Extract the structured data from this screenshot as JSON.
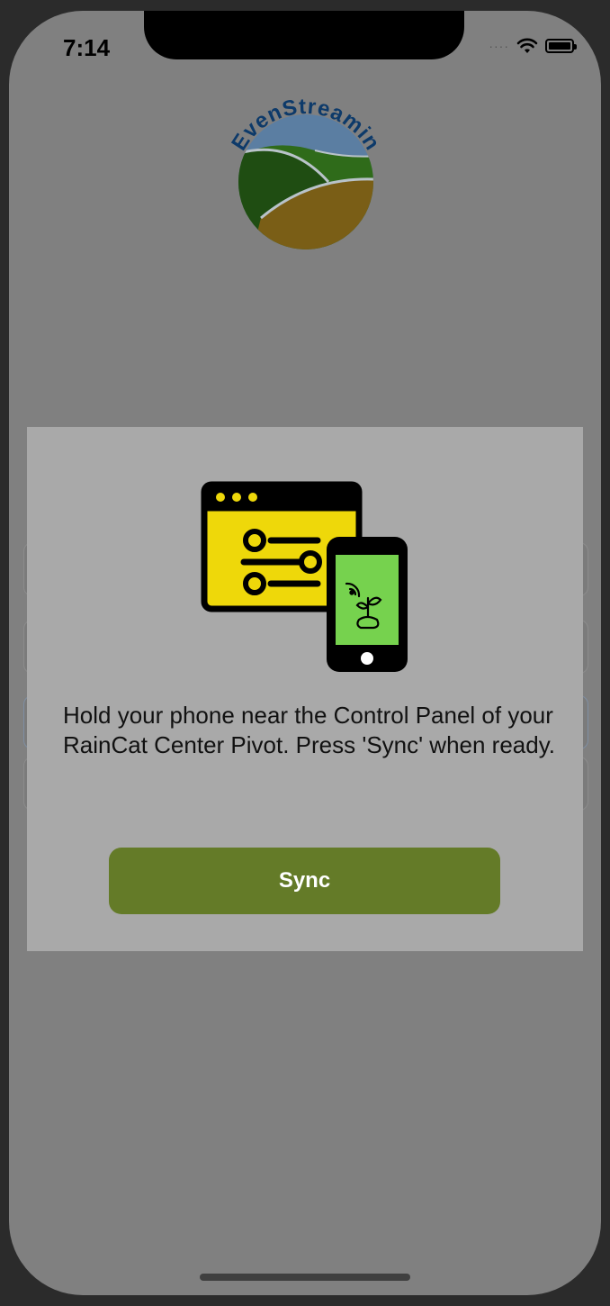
{
  "status_bar": {
    "time": "7:14",
    "icons": [
      "cellular-signal-icon",
      "wifi-icon",
      "battery-icon"
    ]
  },
  "logo": {
    "text": "EvenStreamin",
    "colors": {
      "sky": "#5b7ea2",
      "hill_dark": "#1f4d12",
      "hill_green": "#2f6b1a",
      "field": "#7a5e16",
      "text": "#0d3a6a"
    }
  },
  "modal": {
    "illustration": [
      "control-panel-icon",
      "smartphone-icon",
      "plant-signal-icon"
    ],
    "message": "Hold your phone near the Control Panel of your RainCat Center Pivot. Press 'Sync' when ready.",
    "sync_label": "Sync"
  },
  "colors": {
    "overlay": "#808080",
    "modal_bg": "#a9a9a9",
    "button_bg": "#647b28",
    "panel_yellow": "#eed80a",
    "phone_screen": "#76d24e"
  }
}
